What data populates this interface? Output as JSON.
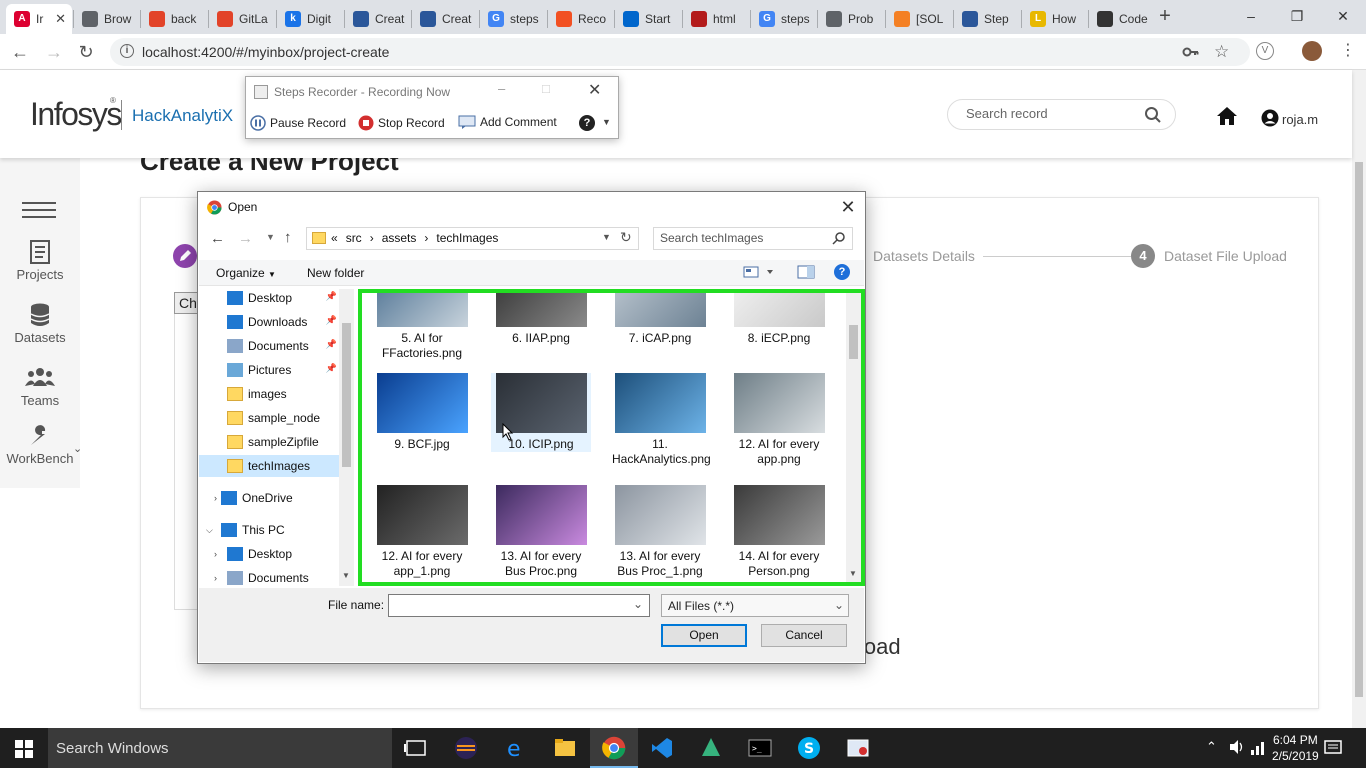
{
  "browser": {
    "tabs": [
      {
        "label": "Ir",
        "color": "#dd0031",
        "letter": "A"
      },
      {
        "label": "Brow",
        "color": "#5f6368",
        "letter": ""
      },
      {
        "label": "back",
        "color": "#e24329",
        "letter": ""
      },
      {
        "label": "GitLa",
        "color": "#e24329",
        "letter": ""
      },
      {
        "label": "Digit",
        "color": "#1a73e8",
        "letter": "k"
      },
      {
        "label": "Creat",
        "color": "#2b579a",
        "letter": ""
      },
      {
        "label": "Creat",
        "color": "#2b579a",
        "letter": ""
      },
      {
        "label": "steps",
        "color": "#4285f4",
        "letter": "G"
      },
      {
        "label": "Reco",
        "color": "#f25022",
        "letter": ""
      },
      {
        "label": "Start",
        "color": "#0066cc",
        "letter": ""
      },
      {
        "label": "html",
        "color": "#b31b1b",
        "letter": ""
      },
      {
        "label": "steps",
        "color": "#4285f4",
        "letter": "G"
      },
      {
        "label": "Prob",
        "color": "#5f6368",
        "letter": ""
      },
      {
        "label": "[SOL",
        "color": "#f48024",
        "letter": ""
      },
      {
        "label": "Step",
        "color": "#2b579a",
        "letter": ""
      },
      {
        "label": "How",
        "color": "#e8b800",
        "letter": "L"
      },
      {
        "label": "Code",
        "color": "#333333",
        "letter": ""
      }
    ],
    "url": "localhost:4200/#/myinbox/project-create"
  },
  "app": {
    "logo": "Infosys",
    "logo_reg": "®",
    "product": "HackAnalytiX",
    "search_placeholder": "Search record",
    "user": "roja.m",
    "page_title": "Create a New Project",
    "nav": [
      {
        "label": "Projects",
        "icon": "document-icon"
      },
      {
        "label": "Datasets",
        "icon": "database-icon"
      },
      {
        "label": "Teams",
        "icon": "people-icon"
      },
      {
        "label": "WorkBench",
        "icon": "wrench-icon"
      }
    ],
    "steps": {
      "step3_label": "Datasets Details",
      "step4_num": "4",
      "step4_label": "Dataset File Upload"
    },
    "partial_button": "Ch",
    "partial_upload_text": "load",
    "accent": "#1a6fb0",
    "step_badge_color": "#8e44ad"
  },
  "recorder": {
    "title": "Steps Recorder - Recording Now",
    "pause": "Pause Record",
    "stop": "Stop Record",
    "add_comment": "Add Comment"
  },
  "dialog": {
    "title": "Open",
    "breadcrumb": [
      "«",
      "src",
      "assets",
      "techImages"
    ],
    "search_placeholder": "Search techImages",
    "organize": "Organize",
    "new_folder": "New folder",
    "tree": [
      {
        "label": "Desktop",
        "pinned": true,
        "type": "desktop"
      },
      {
        "label": "Downloads",
        "pinned": true,
        "type": "download"
      },
      {
        "label": "Documents",
        "pinned": true,
        "type": "doc"
      },
      {
        "label": "Pictures",
        "pinned": true,
        "type": "pic"
      },
      {
        "label": "images",
        "pinned": false,
        "type": "folder"
      },
      {
        "label": "sample_node",
        "pinned": false,
        "type": "folder"
      },
      {
        "label": "sampleZipfile",
        "pinned": false,
        "type": "folder"
      },
      {
        "label": "techImages",
        "pinned": false,
        "type": "folder",
        "selected": true
      },
      {
        "label": "OneDrive",
        "pinned": false,
        "type": "cloud"
      },
      {
        "label": "This PC",
        "pinned": false,
        "type": "pc"
      },
      {
        "label": "Desktop",
        "pinned": false,
        "type": "desktop"
      },
      {
        "label": "Documents",
        "pinned": false,
        "type": "doc"
      }
    ],
    "files": [
      {
        "name": "5. AI for FFactories.png",
        "c1": "#5a7c9a",
        "c2": "#c8d3dc"
      },
      {
        "name": "6. IIAP.png",
        "c1": "#3b3b3b",
        "c2": "#8a8a8a"
      },
      {
        "name": "7. iCAP.png",
        "c1": "#b7c2cc",
        "c2": "#6d8294"
      },
      {
        "name": "8. iECP.png",
        "c1": "#f0f0f0",
        "c2": "#c9c9c9"
      },
      {
        "name": "9. BCF.jpg",
        "c1": "#0a3d8f",
        "c2": "#4aa3ff"
      },
      {
        "name": "10. ICIP.png",
        "c1": "#2a2f36",
        "c2": "#5b6470",
        "selected": true
      },
      {
        "name": "11. HackAnalytics.png",
        "c1": "#1d4f7a",
        "c2": "#6db3e8"
      },
      {
        "name": "12. AI for every app.png",
        "c1": "#6e7e87",
        "c2": "#d8dde0"
      },
      {
        "name": "12. AI for every app_1.png",
        "c1": "#222222",
        "c2": "#6b6b6b"
      },
      {
        "name": "13. AI for every Bus Proc.png",
        "c1": "#3c2a5e",
        "c2": "#c98adf"
      },
      {
        "name": "13. AI for every Bus Proc_1.png",
        "c1": "#8c95a0",
        "c2": "#e0e4e8"
      },
      {
        "name": "14. AI for every Person.png",
        "c1": "#3a3a3a",
        "c2": "#9a9a9a"
      }
    ],
    "filename_label": "File name:",
    "filename_value": "",
    "filetype": "All Files (*.*)",
    "open": "Open",
    "cancel": "Cancel",
    "highlight_color": "#22dd22"
  },
  "taskbar": {
    "search": "Search Windows",
    "time": "6:04 PM",
    "date": "2/5/2019"
  }
}
